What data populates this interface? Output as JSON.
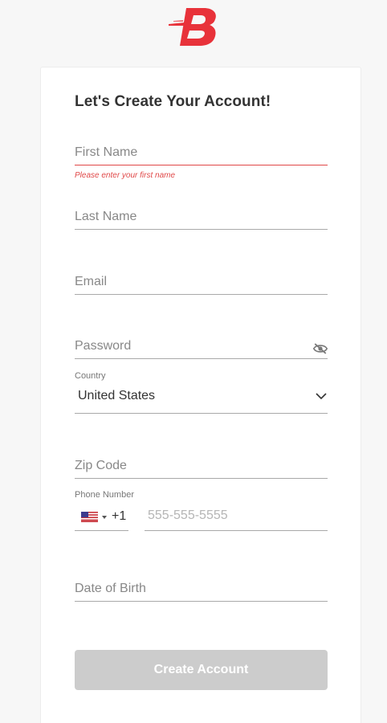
{
  "brand": {
    "logo_icon": "brand-b-logo-icon",
    "color": "#e8323a"
  },
  "form": {
    "title": "Let's Create Your Account!",
    "first_name": {
      "placeholder": "First Name",
      "value": "",
      "error": "Please enter your first name"
    },
    "last_name": {
      "placeholder": "Last Name",
      "value": ""
    },
    "email": {
      "placeholder": "Email",
      "value": ""
    },
    "password": {
      "placeholder": "Password",
      "value": "",
      "toggle_icon": "eye-off-icon"
    },
    "country": {
      "label": "Country",
      "value": "United States"
    },
    "zip": {
      "placeholder": "Zip Code",
      "value": ""
    },
    "phone": {
      "label": "Phone Number",
      "flag_icon": "us-flag-icon",
      "dial_code": "+1",
      "placeholder": "555-555-5555",
      "value": ""
    },
    "dob": {
      "placeholder": "Date of Birth",
      "value": ""
    },
    "submit_label": "Create Account"
  },
  "colors": {
    "error": "#e04848",
    "button_disabled": "#cccccc",
    "background": "#f7f7f7"
  }
}
